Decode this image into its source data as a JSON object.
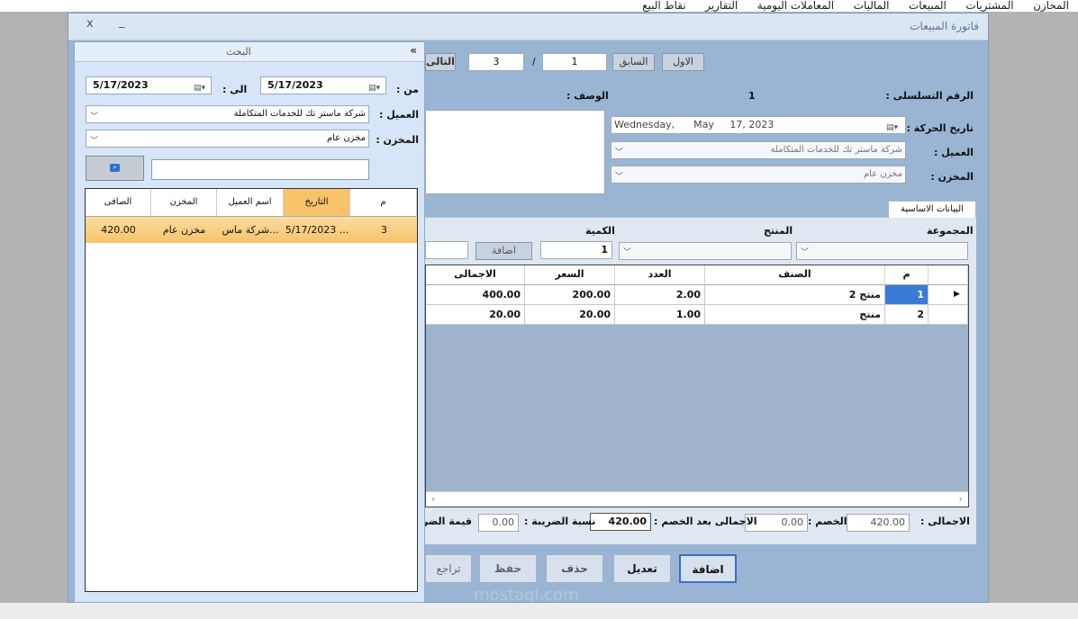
{
  "top_menu": [
    "المخازن",
    "المشتريات",
    "المبيعات",
    "الماليات",
    "المعاملات اليومية",
    "التقارير",
    "نقاط البيع"
  ],
  "main_window": {
    "title": "فاتورة المبيعات",
    "close_glyph": "x",
    "minimize_glyph": "_"
  },
  "nav": {
    "first": "الاول",
    "prev": "السابق",
    "current": "1",
    "separator": "/",
    "total": "3",
    "next": "التالى"
  },
  "form": {
    "serial_label": "الرقم التسلسلى :",
    "serial_value": "1",
    "description_label": "الوصف :",
    "date_label": "تاريخ الحركة :",
    "date_value": "Wednesday,      May     17, 2023",
    "customer_label": "العميل :",
    "customer_value": "شركة ماستر تك للخدمات المتكاملة",
    "store_label": "المخزن :",
    "store_value": "مخزن عام"
  },
  "tab_label": "البيانات الاساسية",
  "entry": {
    "group_label": "المجموعة",
    "product_label": "المنتج",
    "qty_label": "الكمية",
    "qty_value": "1",
    "add_label": "اضافة"
  },
  "grid": {
    "headers": {
      "num": "م",
      "item": "الصنف",
      "count": "العدد",
      "price": "السعر",
      "total": "الاجمالى"
    },
    "rows": [
      {
        "num": "1",
        "item": "منتج 2",
        "count": "2.00",
        "price": "200.00",
        "total": "400.00"
      },
      {
        "num": "2",
        "item": "منتج",
        "count": "1.00",
        "price": "20.00",
        "total": "20.00"
      }
    ]
  },
  "totals": {
    "total_label": "الاجمالى :",
    "total_value": "420.00",
    "discount_label": "الخصم :",
    "discount_value": "0.00",
    "after_discount_label": "الاجمالى بعد الخصم :",
    "after_discount_value": "420.00",
    "tax_rate_label": "نسبة الضريبة :",
    "tax_rate_value": "0.00",
    "tax_value_label": "قيمة الضريبة"
  },
  "actions": {
    "add": "اضافة",
    "edit": "تعديل",
    "delete": "حذف",
    "save": "حفظ",
    "undo": "تراجع"
  },
  "search_panel": {
    "title": "البحث",
    "collapse_glyph": "«",
    "from_label": "من :",
    "from_value": "5/17/2023",
    "to_label": "الى :",
    "to_value": "5/17/2023",
    "customer_label": "العميل :",
    "customer_value": "شركة ماستر تك للخدمات المتكاملة",
    "store_label": "المخزن :",
    "store_value": "مخزن عام",
    "search_placeholder": "",
    "headers": {
      "num": "م",
      "date": "التاريخ",
      "customer": "اسم العميل",
      "store": "المخزن",
      "net": "الصافى"
    },
    "rows": [
      {
        "num": "3",
        "date": "5/17/2023 ...",
        "customer": "شركة ماس...",
        "store": "مخزن عام",
        "net": "420.00"
      }
    ]
  },
  "watermark": "mostaql.com",
  "colors": {
    "accent": "#3a6fc4",
    "selected_row": "#f6c36a",
    "window_bg": "#9ab5d4"
  }
}
